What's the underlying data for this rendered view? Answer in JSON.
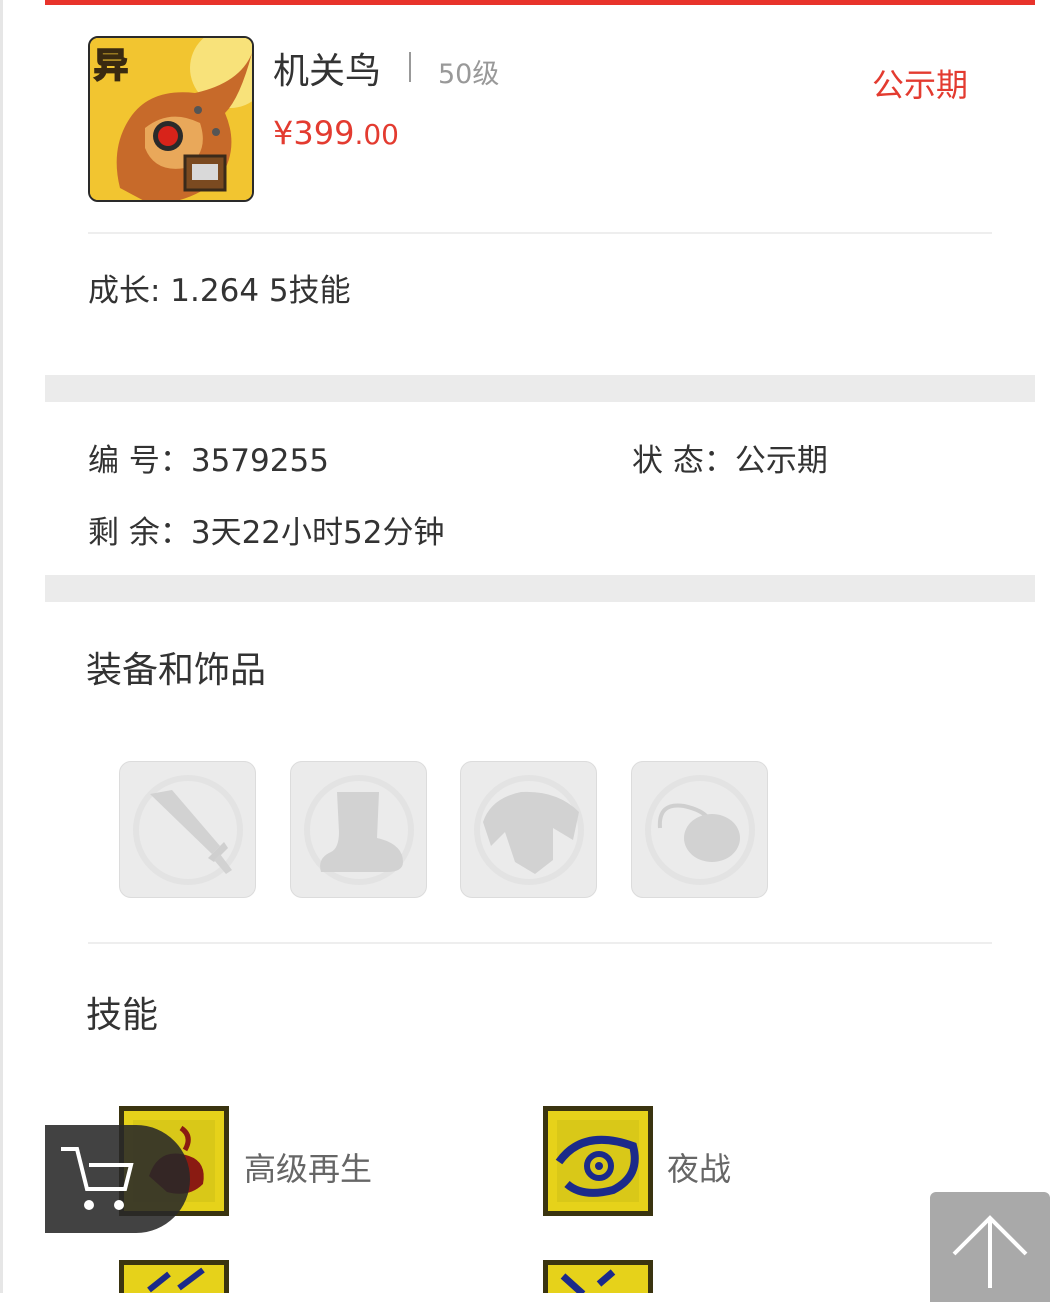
{
  "header": {
    "name": "机关鸟",
    "level": "50级",
    "price_main": "¥399",
    "price_decimal": ".00",
    "status_badge": "公示期",
    "avatar_badge": "异"
  },
  "growth_line": "成长: 1.264  5技能",
  "info": {
    "id_label": "编  号：",
    "id_value": "3579255",
    "status_label": "状  态：",
    "status_value": "公示期",
    "remain_label": "剩  余：",
    "remain_value": "3天22小时52分钟"
  },
  "equipment": {
    "title": "装备和饰品",
    "slots": [
      "sword-icon",
      "boot-icon",
      "armor-icon",
      "necklace-icon"
    ]
  },
  "skills": {
    "title": "技能",
    "items": [
      {
        "label": "高级再生",
        "icon": "regeneration-icon"
      },
      {
        "label": "夜战",
        "icon": "night-eye-icon"
      }
    ]
  },
  "floating": {
    "cart": "cart-icon",
    "back_to_top": "arrow-up-icon"
  },
  "colors": {
    "accent_red": "#e8332b",
    "price_red": "#e33b30",
    "skill_yellow": "#e6d21a"
  }
}
